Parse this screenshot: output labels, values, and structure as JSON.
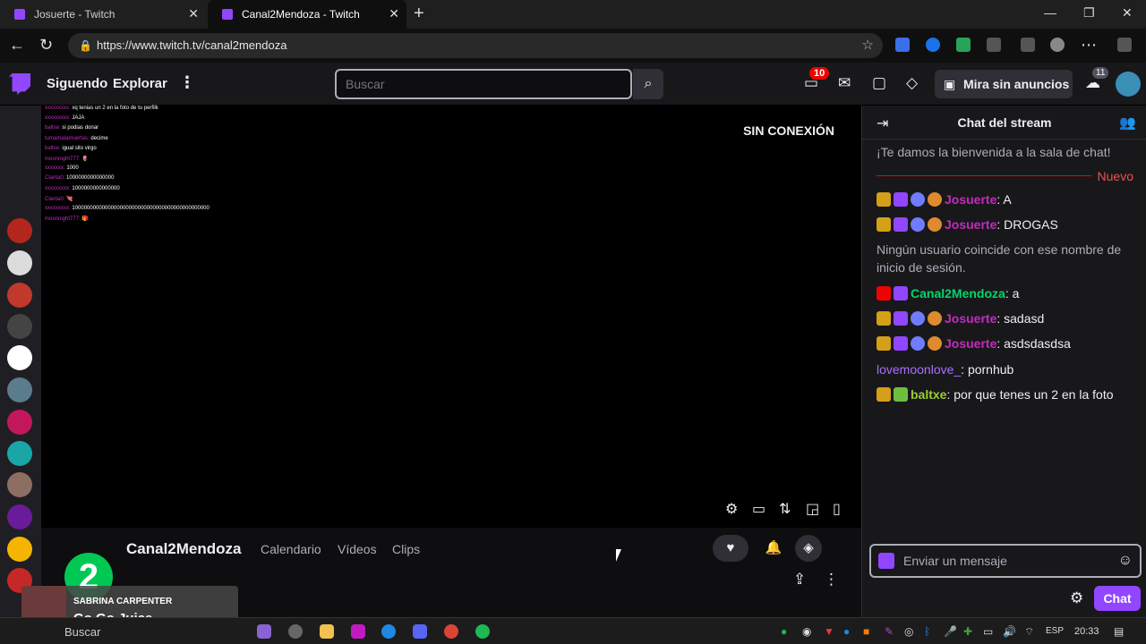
{
  "browser": {
    "tabs": [
      {
        "title": "Josuerte - Twitch",
        "active": false
      },
      {
        "title": "Canal2Mendoza - Twitch",
        "active": true
      }
    ],
    "url": "https://www.twitch.tv/canal2mendoza"
  },
  "topnav": {
    "following": "Siguendo",
    "explore": "Explorar",
    "search_placeholder": "Buscar",
    "notifications_count": "10",
    "ad_free_label": "Mira sin anuncios",
    "count_badge": "11"
  },
  "player": {
    "status": "SIN CONEXIÓN",
    "overlay_chat": [
      {
        "user": "xxxxxxxxx",
        "text": "xq tenias un 2 en la foto de tu perfilk"
      },
      {
        "user": "xxxxxxxxx",
        "text": "JAJA"
      },
      {
        "user": "baltxe",
        "text": "si podias donar"
      },
      {
        "user": "tumamalamuertas",
        "text": "decime"
      },
      {
        "user": "baltxe",
        "text": "igual sito virgo"
      },
      {
        "user": "moonnight777",
        "text": "🌷"
      },
      {
        "user": "xxxxxxx",
        "text": "1000"
      },
      {
        "user": "Clarita0",
        "text": "1000000000000000"
      },
      {
        "user": "xxxxxxxxx",
        "text": "1000000000000000"
      },
      {
        "user": "Clarita0",
        "text": "💘"
      },
      {
        "user": "xxxxxxxxx",
        "text": "1000000000000000000000000000000000000000000000"
      },
      {
        "user": "moonnight777",
        "text": "🎁"
      }
    ]
  },
  "channel": {
    "avatar_text": "2",
    "name": "Canal2Mendoza",
    "tabs": [
      "Calendario",
      "Vídeos",
      "Clips"
    ]
  },
  "chat": {
    "title": "Chat del stream",
    "welcome": "¡Te damos la bienvenida a la sala de chat!",
    "new_label": "Nuevo",
    "messages": [
      {
        "user": "Josuerte",
        "text": ": A"
      },
      {
        "user": "Josuerte",
        "text": ": DROGAS"
      },
      {
        "system": "Ningún usuario coincide con ese nombre de inicio de sesión."
      },
      {
        "user": "Canal2Mendoza",
        "text": ": a"
      },
      {
        "user": "Josuerte",
        "text": ": sadasd"
      },
      {
        "user": "Josuerte",
        "text": ": asdsdasdsa"
      },
      {
        "user": "lovemoonlove_",
        "text": ": pornhub"
      },
      {
        "user": "baltxe",
        "text": ": por que tenes un 2 en la foto"
      }
    ],
    "input_placeholder": "Enviar un mensaje",
    "chat_button": "Chat"
  },
  "music": {
    "artist": "SABRINA CARPENTER",
    "song": "Go Go Juice"
  },
  "taskbar": {
    "search": "Buscar",
    "lang": "ESP",
    "time": "20:33"
  },
  "colors": {
    "twitch_purple": "#9146ff",
    "live_red": "#eb0400"
  }
}
